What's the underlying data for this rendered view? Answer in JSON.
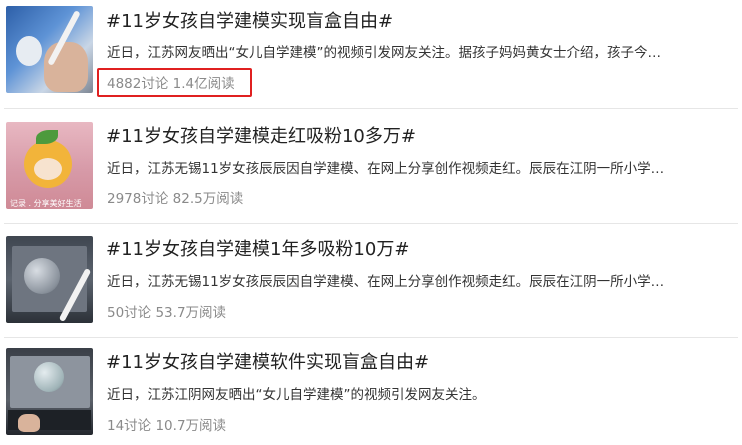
{
  "topics": [
    {
      "title": "#11岁女孩自学建模实现盲盒自由#",
      "summary": "近日，江苏网友晒出“女儿自学建模”的视频引发网友关注。据孩子妈妈黄女士介绍，孩子今…",
      "stats": "4882讨论 1.4亿阅读",
      "highlighted": true
    },
    {
      "title": "#11岁女孩自学建模走红吸粉10多万#",
      "summary": "近日，江苏无锡11岁女孩辰辰因自学建模、在网上分享创作视频走红。辰辰在江阴一所小学…",
      "stats": "2978讨论 82.5万阅读",
      "thumb_caption": "记录 . 分享美好生活"
    },
    {
      "title": "#11岁女孩自学建模1年多吸粉10万#",
      "summary": "近日，江苏无锡11岁女孩辰辰因自学建模、在网上分享创作视频走红。辰辰在江阴一所小学…",
      "stats": "50讨论 53.7万阅读"
    },
    {
      "title": "#11岁女孩自学建模软件实现盲盒自由#",
      "summary": "近日，江苏江阴网友晒出“女儿自学建模”的视频引发网友关注。",
      "stats": "14讨论 10.7万阅读"
    }
  ],
  "colors": {
    "highlight_border": "#e02020",
    "stats_text": "#8a8a8a",
    "divider": "#e6e6e6"
  }
}
